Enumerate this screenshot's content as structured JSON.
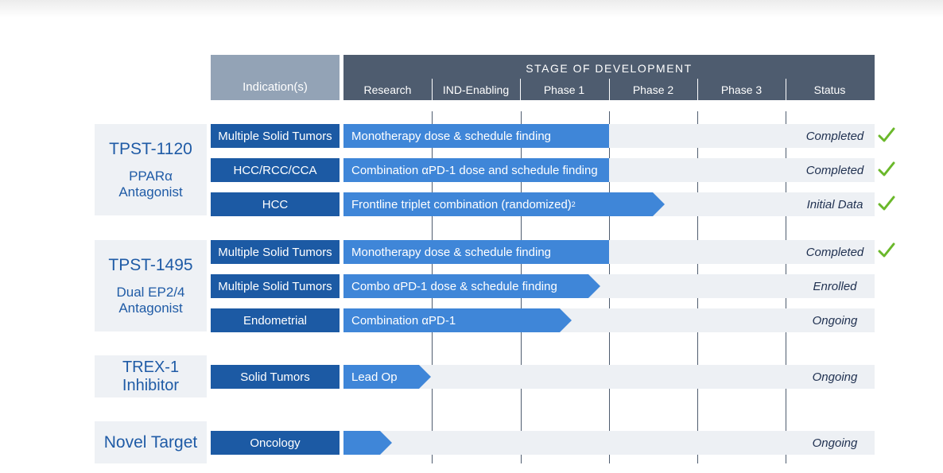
{
  "header": {
    "indication_label": "Indication(s)",
    "stage_title": "STAGE OF DEVELOPMENT",
    "stages": [
      "Research",
      "IND-Enabling",
      "Phase 1",
      "Phase 2",
      "Phase 3",
      "Status"
    ]
  },
  "groups": [
    {
      "name": "TPST-1120",
      "subtitle": "PPARα\nAntagonist"
    },
    {
      "name": "TPST-1495",
      "subtitle": "Dual EP2/4\nAntagonist"
    },
    {
      "name": "TREX-1\nInhibitor",
      "subtitle": ""
    },
    {
      "name": "Novel Target",
      "subtitle": ""
    }
  ],
  "rows": [
    {
      "indication": "Multiple Solid Tumors",
      "bar_label": "Monotherapy dose & schedule finding",
      "status": "Completed",
      "checked": true
    },
    {
      "indication": "HCC/RCC/CCA",
      "bar_label": "Combination αPD-1 dose and schedule finding",
      "status": "Completed",
      "checked": true
    },
    {
      "indication": "HCC",
      "bar_label": "Frontline triplet combination (randomized)",
      "bar_sup": "2",
      "status": "Initial Data",
      "checked": true
    },
    {
      "indication": "Multiple Solid Tumors",
      "bar_label": "Monotherapy dose & schedule finding",
      "status": "Completed",
      "checked": true
    },
    {
      "indication": "Multiple Solid Tumors",
      "bar_label": "Combo αPD-1 dose & schedule finding",
      "status": "Enrolled",
      "checked": false
    },
    {
      "indication": "Endometrial",
      "bar_label": "Combination αPD-1",
      "status": "Ongoing",
      "checked": false
    },
    {
      "indication": "Solid Tumors",
      "bar_label": "Lead Op",
      "status": "Ongoing",
      "checked": false
    },
    {
      "indication": "Oncology",
      "bar_label": "",
      "status": "Ongoing",
      "checked": false
    }
  ],
  "colors": {
    "header_dark": "#4e5c6f",
    "header_light": "#93a3b6",
    "indication_box": "#1c5aa4",
    "progress_bar": "#3f86d8",
    "band": "#edf0f4",
    "check": "#6ab82a"
  },
  "icons": {
    "check": "check-icon"
  }
}
